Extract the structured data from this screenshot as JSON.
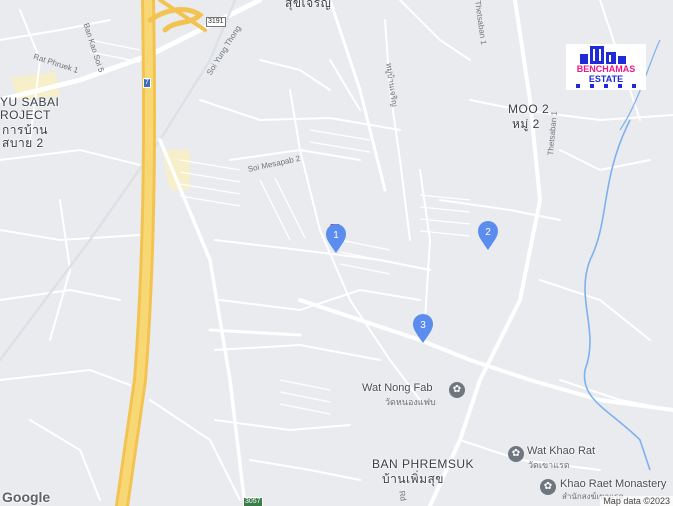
{
  "map": {
    "area_labels": [
      {
        "id": "yusabai-1",
        "text": "YU SABAI"
      },
      {
        "id": "yusabai-2",
        "text": "ROJECT"
      },
      {
        "id": "yusabai-3",
        "text": "การบ้าน"
      },
      {
        "id": "yusabai-4",
        "text": "สบาย 2"
      },
      {
        "id": "moo2",
        "text": "MOO 2"
      },
      {
        "id": "moo2-th",
        "text": "หมู่ 2"
      },
      {
        "id": "top-th",
        "text": "สุขเจริญ"
      },
      {
        "id": "banphremsuk",
        "text": "BAN PHREMSUK"
      },
      {
        "id": "banphremsuk-th",
        "text": "บ้านเพิ่มสุข"
      }
    ],
    "street_labels": [
      {
        "id": "bankao",
        "text": "Ban Kao Soi 5"
      },
      {
        "id": "phruek",
        "text": "Rat Phruek 1"
      },
      {
        "id": "yungthong",
        "text": "Soi Yung Thong"
      },
      {
        "id": "mesapab",
        "text": "Soi Mesapab 2"
      },
      {
        "id": "thetsaban",
        "text": "Thetsaban 1"
      },
      {
        "id": "thetsaban-top",
        "text": "Thetsaban 1"
      },
      {
        "id": "moo-th-road",
        "text": "หมู่บ้านเจริญ"
      },
      {
        "id": "rd",
        "text": "Rd"
      }
    ],
    "pois": [
      {
        "id": "wat-nong-fab",
        "name": "Wat Nong Fab",
        "sub": "วัดหนองแฟบ"
      },
      {
        "id": "wat-khao-rat",
        "name": "Wat Khao Rat",
        "sub": "วัดเขาแรด"
      },
      {
        "id": "khao-raet",
        "name": "Khao Raet Monastery",
        "sub": "สำนักสงฆ์เขาแรด"
      }
    ],
    "markers": [
      {
        "id": "marker-1",
        "label": "1",
        "color": "#5b8def"
      },
      {
        "id": "marker-2",
        "label": "2",
        "color": "#5b8def"
      },
      {
        "id": "marker-3",
        "label": "3",
        "color": "#5b8def"
      }
    ],
    "highway_shields": [
      {
        "id": "shield-7",
        "text": "7"
      },
      {
        "id": "shield-3191",
        "text": "3191"
      },
      {
        "id": "shield-3057",
        "text": "3057"
      }
    ],
    "logo": {
      "text_a": "BENCHAMAS",
      "text_b": "ESTATE"
    },
    "google": "Google",
    "attribution": "Map data ©2023"
  }
}
